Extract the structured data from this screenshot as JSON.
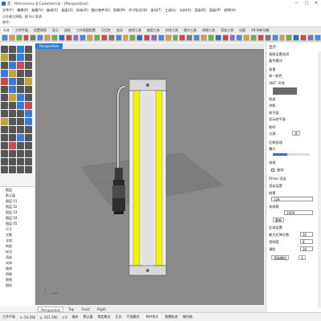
{
  "window": {
    "title": "无 - Rhinoceros 8 Commercial - [Perspective]",
    "controls": [
      "—",
      "□",
      "✕"
    ]
  },
  "menu": [
    "文件(F)",
    "编辑(E)",
    "查看(V)",
    "曲线(C)",
    "曲面(S)",
    "实体(O)",
    "细分物件(D)",
    "网格(M)",
    "尺寸标注(D)",
    "变动(T)",
    "工具(L)",
    "分析(A)",
    "渲染(R)",
    "面板(P)",
    "说明(H)"
  ],
  "command": {
    "line1": "正在建立网格...按 Esc 取消",
    "line2": "指令:"
  },
  "toolbar_tabs": [
    "标准",
    "工作平面",
    "设置视图",
    "显示",
    "选取",
    "工作视窗配置",
    "可见性",
    "变动",
    "曲线工具",
    "曲面工具",
    "实体工具",
    "细分工具",
    "网格工具",
    "渲染工具",
    "出图",
    "V8 的新功能"
  ],
  "toolbar_icon_colors": [
    "#4a8ad8",
    "#d4a23a",
    "#6ab04c",
    "#c94a4a",
    "#7a7a7a",
    "#4a8ad8",
    "#d4a23a",
    "#6ab04c",
    "#2f6bbf",
    "#c94a4a",
    "#8e6ac2",
    "#4a8ad8",
    "#d4a23a",
    "#6ab04c",
    "#c94a4a",
    "#7a7a7a",
    "#4a8ad8",
    "#d4a23a",
    "#6ab04c",
    "#2f6bbf",
    "#c94a4a",
    "#8e6ac2",
    "#4a8ad8",
    "#d4a23a",
    "#6ab04c",
    "#c94a4a",
    "#7a7a7a",
    "#4a8ad8",
    "#d4a23a",
    "#6ab04c",
    "#2f6bbf",
    "#c94a4a",
    "#8e6ac2",
    "#4a8ad8",
    "#d4a23a",
    "#6ab04c",
    "#c94a4a",
    "#7a7a7a",
    "#4a8ad8",
    "#d4a23a",
    "#6ab04c",
    "#2f6bbf",
    "#c94a4a",
    "#8e6ac2",
    "#4a8ad8"
  ],
  "left_tool_colors": [
    "#555",
    "#555",
    "#3a7ad0",
    "#555",
    "#c4a23a",
    "#555",
    "#3a7ad0",
    "#555",
    "#555",
    "#3a7ad0",
    "#c94a4a",
    "#555",
    "#3a7ad0",
    "#c4a23a",
    "#555",
    "#555",
    "#c94a4a",
    "#3a7ad0",
    "#555",
    "#c4a23a",
    "#555",
    "#3a7ad0",
    "#555",
    "#555",
    "#555",
    "#c4a23a",
    "#3a7ad0",
    "#555",
    "#555",
    "#555",
    "#3a7ad0",
    "#c94a4a",
    "#555",
    "#555",
    "#555",
    "#3a7ad0",
    "#c4a23a",
    "#555",
    "#555",
    "#3a7ad0",
    "#555",
    "#555",
    "#555",
    "#555",
    "#555",
    "#555",
    "#3a7ad0",
    "#555",
    "#555",
    "#c94a4a",
    "#555",
    "#555",
    "#555",
    "#555",
    "#555",
    "#555",
    "#555",
    "#555",
    "#555",
    "#555",
    "#555",
    "#555",
    "#555",
    "#555"
  ],
  "layers": [
    "图层",
    "默认值",
    "图层 01",
    "图层 02",
    "图层 03",
    "图层 04",
    "图层 05",
    "尺寸",
    "注解",
    "全部",
    "构造",
    "标注",
    "渲染",
    "实体",
    "曲线",
    "网格",
    "视图",
    "图纸"
  ],
  "viewport": {
    "tab_label": "Perspective"
  },
  "bottom_tabs": [
    "Perspective",
    "Top",
    "Front",
    "Right"
  ],
  "status": {
    "cplane": "工作平面",
    "x": "x -54.256",
    "y": "y -311.500",
    "z": "z 0",
    "units": "毫米",
    "default": "默认值",
    "lock_grid": "锁定格点",
    "ortho": "正交",
    "planar": "平面模式",
    "osnap": "物件锁点",
    "smarttrack": "智慧轨迹",
    "gumball": "操作轴",
    "record_history": "记录建构历史",
    "filter": "过滤器"
  },
  "right_panel": {
    "title": "显示",
    "section1": "视图设置选项",
    "viewport_mode": "着色模式",
    "section2": "背景",
    "bg_option": "单一颜色",
    "section3": "360° 环境",
    "section4": "地面",
    "shadows": "阴影",
    "section5": "底平面",
    "ground_plane": "显示底平面",
    "section6": "照明",
    "lights": "光源",
    "on_label": "开",
    "section7": "后期处理",
    "exposure": "曝光",
    "section8": "线框",
    "curves": "曲线",
    "section9": "Rhino 渲染",
    "section10": "渲染设置",
    "field1_label": "结果",
    "field1_value": "128",
    "field2_label": "采样数",
    "field2_value": "1000",
    "btn_update": "更新",
    "section11": "区域设置",
    "max_bounces": "最大反弹次数",
    "max_bounces_value": "32",
    "transparency": "透明度",
    "transparency_value": "8",
    "diffuse": "漫射",
    "diffuse_value": "16",
    "btn_render": "渲染输出",
    "btn_render_value": "3"
  }
}
